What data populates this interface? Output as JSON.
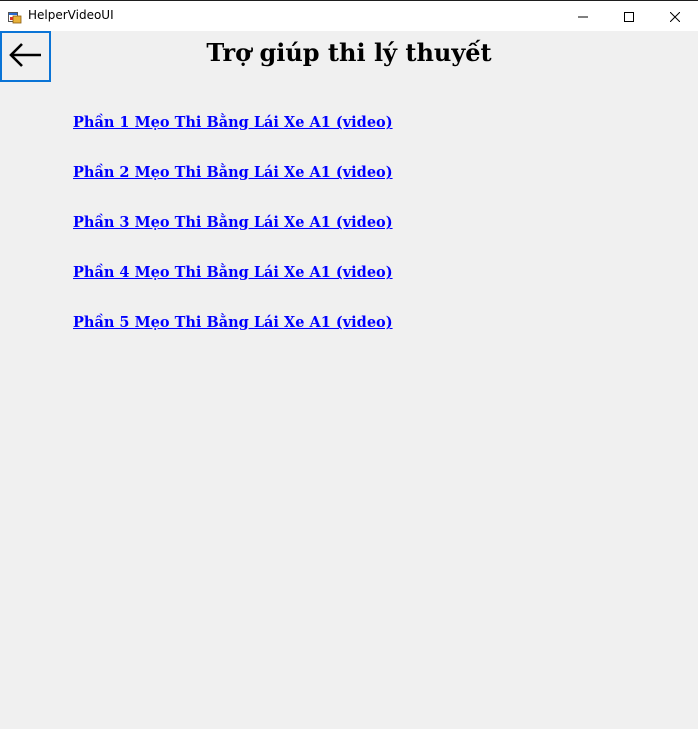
{
  "window": {
    "title": "HelperVideoUI",
    "app_icon": "form-app-icon",
    "controls": {
      "minimize_icon": "minimize-icon",
      "maximize_icon": "maximize-icon",
      "close_icon": "close-icon"
    }
  },
  "header": {
    "back_icon": "arrow-left-icon",
    "title": "Trợ giúp thi lý thuyết"
  },
  "video_links": [
    {
      "label": "Phần 1 Mẹo Thi Bằng Lái Xe A1 (video)"
    },
    {
      "label": "Phần 2 Mẹo Thi Bằng Lái Xe A1 (video)"
    },
    {
      "label": "Phần 3 Mẹo Thi Bằng Lái Xe A1 (video)"
    },
    {
      "label": "Phần 4 Mẹo Thi Bằng Lái Xe A1 (video)"
    },
    {
      "label": "Phần 5 Mẹo Thi Bằng Lái Xe A1 (video)"
    }
  ],
  "colors": {
    "background": "#f0f0f0",
    "link": "#0000ff",
    "back_button_border": "#0a74d6"
  }
}
